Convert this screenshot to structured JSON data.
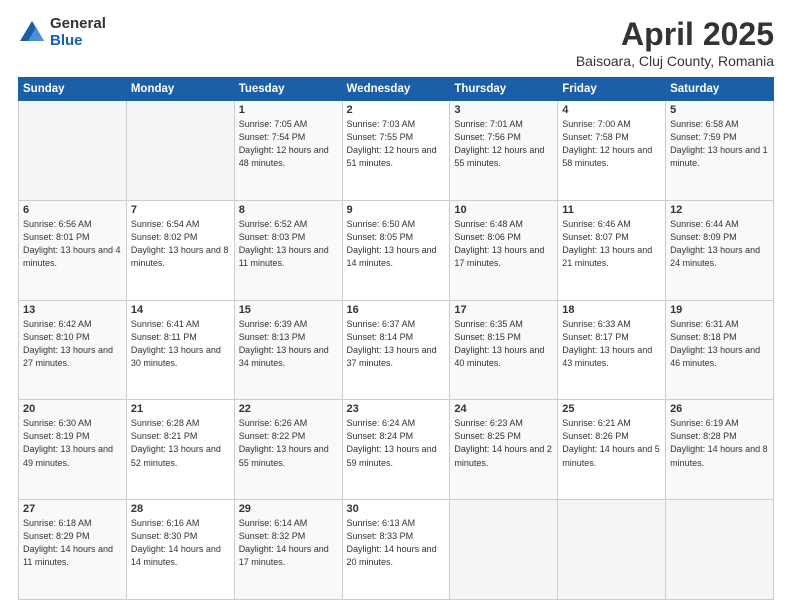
{
  "logo": {
    "general": "General",
    "blue": "Blue"
  },
  "title": "April 2025",
  "location": "Baisoara, Cluj County, Romania",
  "days_header": [
    "Sunday",
    "Monday",
    "Tuesday",
    "Wednesday",
    "Thursday",
    "Friday",
    "Saturday"
  ],
  "weeks": [
    [
      {
        "num": "",
        "detail": ""
      },
      {
        "num": "",
        "detail": ""
      },
      {
        "num": "1",
        "detail": "Sunrise: 7:05 AM\nSunset: 7:54 PM\nDaylight: 12 hours\nand 48 minutes."
      },
      {
        "num": "2",
        "detail": "Sunrise: 7:03 AM\nSunset: 7:55 PM\nDaylight: 12 hours\nand 51 minutes."
      },
      {
        "num": "3",
        "detail": "Sunrise: 7:01 AM\nSunset: 7:56 PM\nDaylight: 12 hours\nand 55 minutes."
      },
      {
        "num": "4",
        "detail": "Sunrise: 7:00 AM\nSunset: 7:58 PM\nDaylight: 12 hours\nand 58 minutes."
      },
      {
        "num": "5",
        "detail": "Sunrise: 6:58 AM\nSunset: 7:59 PM\nDaylight: 13 hours\nand 1 minute."
      }
    ],
    [
      {
        "num": "6",
        "detail": "Sunrise: 6:56 AM\nSunset: 8:01 PM\nDaylight: 13 hours\nand 4 minutes."
      },
      {
        "num": "7",
        "detail": "Sunrise: 6:54 AM\nSunset: 8:02 PM\nDaylight: 13 hours\nand 8 minutes."
      },
      {
        "num": "8",
        "detail": "Sunrise: 6:52 AM\nSunset: 8:03 PM\nDaylight: 13 hours\nand 11 minutes."
      },
      {
        "num": "9",
        "detail": "Sunrise: 6:50 AM\nSunset: 8:05 PM\nDaylight: 13 hours\nand 14 minutes."
      },
      {
        "num": "10",
        "detail": "Sunrise: 6:48 AM\nSunset: 8:06 PM\nDaylight: 13 hours\nand 17 minutes."
      },
      {
        "num": "11",
        "detail": "Sunrise: 6:46 AM\nSunset: 8:07 PM\nDaylight: 13 hours\nand 21 minutes."
      },
      {
        "num": "12",
        "detail": "Sunrise: 6:44 AM\nSunset: 8:09 PM\nDaylight: 13 hours\nand 24 minutes."
      }
    ],
    [
      {
        "num": "13",
        "detail": "Sunrise: 6:42 AM\nSunset: 8:10 PM\nDaylight: 13 hours\nand 27 minutes."
      },
      {
        "num": "14",
        "detail": "Sunrise: 6:41 AM\nSunset: 8:11 PM\nDaylight: 13 hours\nand 30 minutes."
      },
      {
        "num": "15",
        "detail": "Sunrise: 6:39 AM\nSunset: 8:13 PM\nDaylight: 13 hours\nand 34 minutes."
      },
      {
        "num": "16",
        "detail": "Sunrise: 6:37 AM\nSunset: 8:14 PM\nDaylight: 13 hours\nand 37 minutes."
      },
      {
        "num": "17",
        "detail": "Sunrise: 6:35 AM\nSunset: 8:15 PM\nDaylight: 13 hours\nand 40 minutes."
      },
      {
        "num": "18",
        "detail": "Sunrise: 6:33 AM\nSunset: 8:17 PM\nDaylight: 13 hours\nand 43 minutes."
      },
      {
        "num": "19",
        "detail": "Sunrise: 6:31 AM\nSunset: 8:18 PM\nDaylight: 13 hours\nand 46 minutes."
      }
    ],
    [
      {
        "num": "20",
        "detail": "Sunrise: 6:30 AM\nSunset: 8:19 PM\nDaylight: 13 hours\nand 49 minutes."
      },
      {
        "num": "21",
        "detail": "Sunrise: 6:28 AM\nSunset: 8:21 PM\nDaylight: 13 hours\nand 52 minutes."
      },
      {
        "num": "22",
        "detail": "Sunrise: 6:26 AM\nSunset: 8:22 PM\nDaylight: 13 hours\nand 55 minutes."
      },
      {
        "num": "23",
        "detail": "Sunrise: 6:24 AM\nSunset: 8:24 PM\nDaylight: 13 hours\nand 59 minutes."
      },
      {
        "num": "24",
        "detail": "Sunrise: 6:23 AM\nSunset: 8:25 PM\nDaylight: 14 hours\nand 2 minutes."
      },
      {
        "num": "25",
        "detail": "Sunrise: 6:21 AM\nSunset: 8:26 PM\nDaylight: 14 hours\nand 5 minutes."
      },
      {
        "num": "26",
        "detail": "Sunrise: 6:19 AM\nSunset: 8:28 PM\nDaylight: 14 hours\nand 8 minutes."
      }
    ],
    [
      {
        "num": "27",
        "detail": "Sunrise: 6:18 AM\nSunset: 8:29 PM\nDaylight: 14 hours\nand 11 minutes."
      },
      {
        "num": "28",
        "detail": "Sunrise: 6:16 AM\nSunset: 8:30 PM\nDaylight: 14 hours\nand 14 minutes."
      },
      {
        "num": "29",
        "detail": "Sunrise: 6:14 AM\nSunset: 8:32 PM\nDaylight: 14 hours\nand 17 minutes."
      },
      {
        "num": "30",
        "detail": "Sunrise: 6:13 AM\nSunset: 8:33 PM\nDaylight: 14 hours\nand 20 minutes."
      },
      {
        "num": "",
        "detail": ""
      },
      {
        "num": "",
        "detail": ""
      },
      {
        "num": "",
        "detail": ""
      }
    ]
  ]
}
